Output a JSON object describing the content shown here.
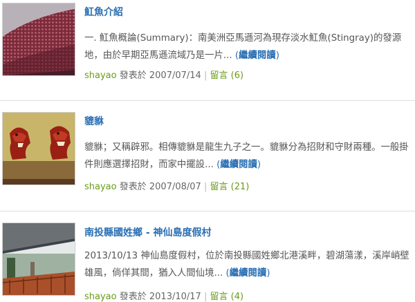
{
  "posts": [
    {
      "title": "魟魚介紹",
      "excerpt": "一. 魟魚概論(Summary)：南美洲亞馬遜河為現存淡水魟魚(Stingray)的發源地，由於早期亞馬遜流域乃是一片...",
      "more_label": "繼續閱讀",
      "author": "shayao",
      "posted_label": "發表於",
      "date": "2007/07/14",
      "comments_label": "留言 (6)",
      "thumb_icon": "stingray-photo"
    },
    {
      "title": "貔貅",
      "excerpt": "貔貅；又稱辟邪。相傳貔貅是龍生九子之一。貔貅分為招財和守財兩種。一般掛件則應選擇招財，而家中擺設...",
      "more_label": "繼續閱讀",
      "author": "shayao",
      "posted_label": "發表於",
      "date": "2007/08/07",
      "comments_label": "留言 (21)",
      "thumb_icon": "pixiu-statues-photo"
    },
    {
      "title": "南投縣國姓鄉 - 神仙島度假村",
      "excerpt": "2013/10/13 神仙島度假村，位於南投縣國姓鄉北港溪畔，碧湖蕩漾，溪岸峭壁雄風，倘佯其間，猶入人間仙境...",
      "more_label": "繼續閱讀",
      "author": "shayao",
      "posted_label": "發表於",
      "date": "2013/10/17",
      "comments_label": "留言 (4)",
      "thumb_icon": "resort-deck-photo"
    }
  ],
  "colors": {
    "link_blue": "#2a6fb3",
    "author_green": "#6a9a1a",
    "text_gray": "#555555",
    "divider": "#dedede"
  }
}
